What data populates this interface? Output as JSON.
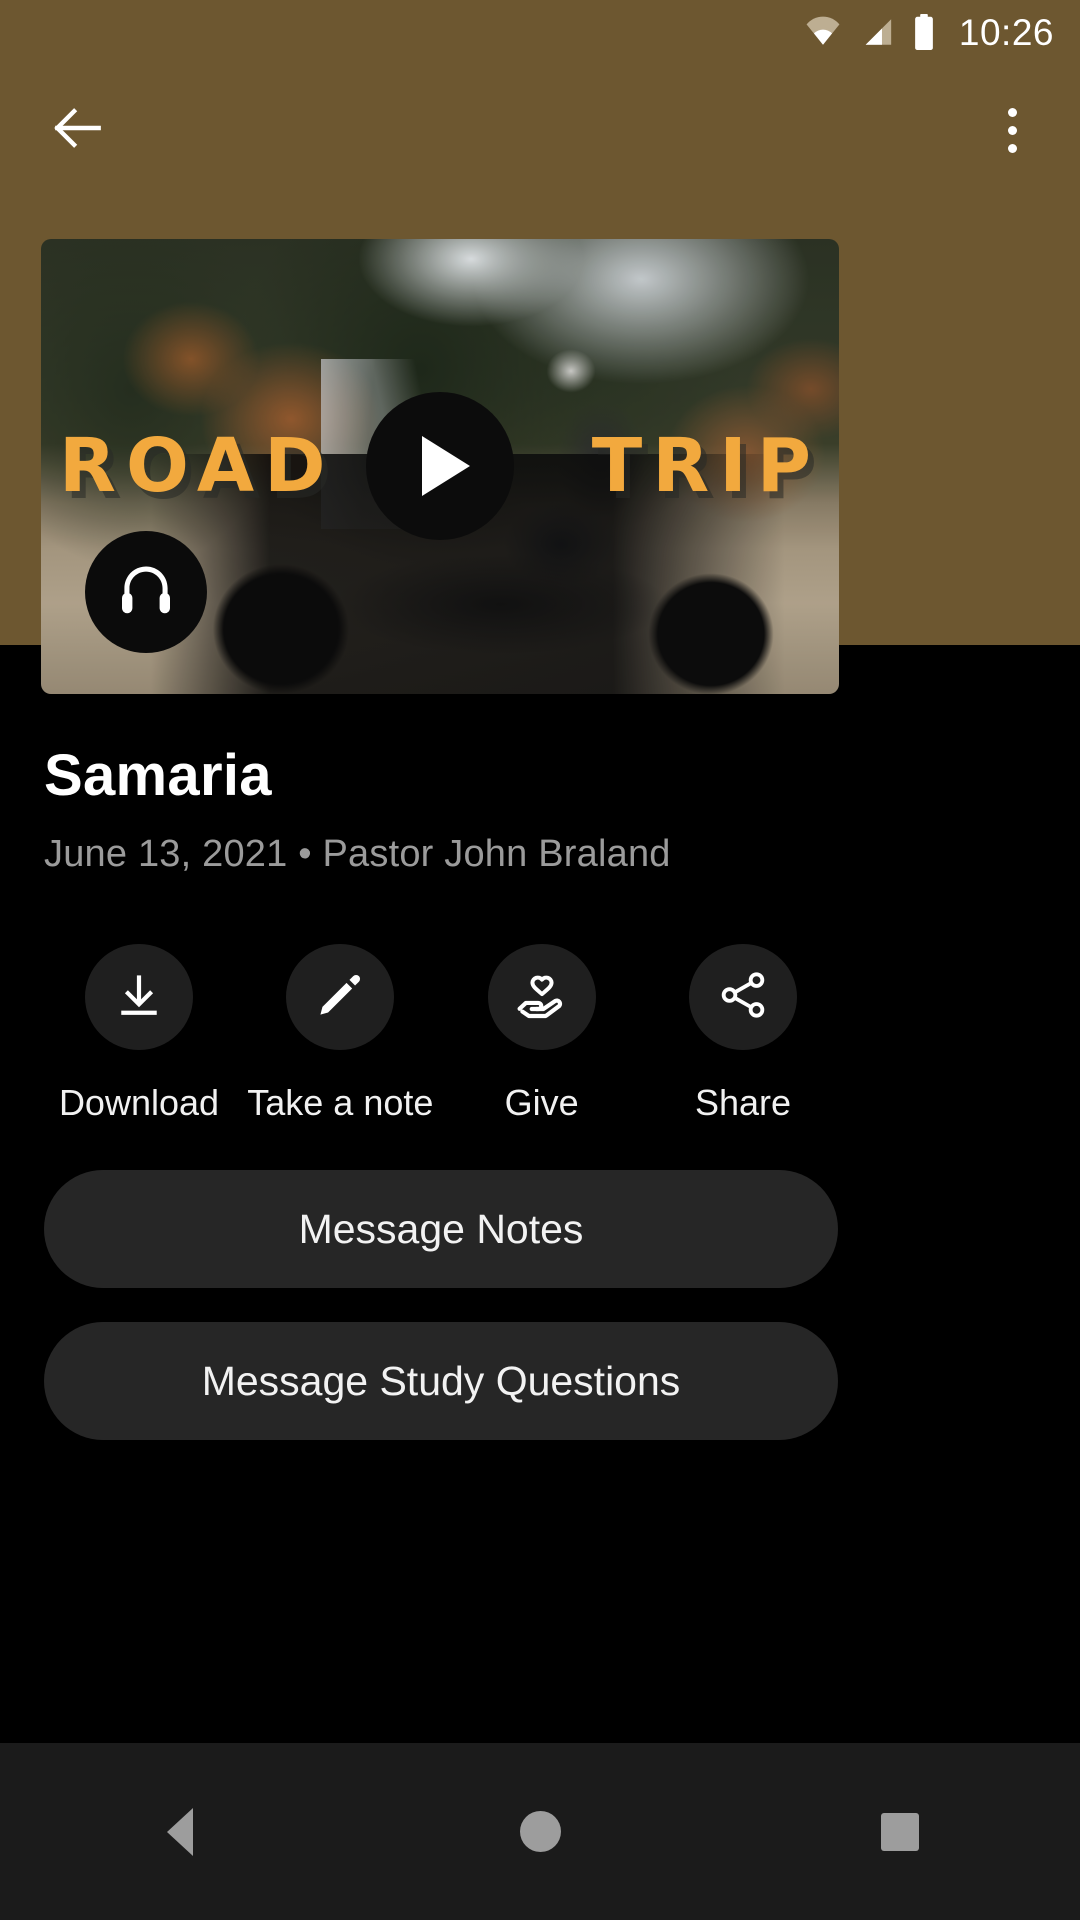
{
  "status_bar": {
    "time": "10:26",
    "icons": [
      "wifi-icon",
      "cellular-signal-icon",
      "battery-icon"
    ]
  },
  "app_bar": {
    "back_icon": "back-arrow-icon",
    "overflow_icon": "overflow-menu-icon"
  },
  "media": {
    "wordmark_left": "ROAD",
    "wordmark_right": "TRIP",
    "play_icon": "play-icon",
    "audio_icon": "headphones-icon"
  },
  "sermon": {
    "title": "Samaria",
    "meta": "June 13, 2021 • Pastor John Braland",
    "date": "June 13, 2021",
    "speaker": "Pastor John Braland"
  },
  "actions": [
    {
      "label": "Download",
      "icon": "download-icon"
    },
    {
      "label": "Take a note",
      "icon": "pencil-icon"
    },
    {
      "label": "Give",
      "icon": "hand-heart-icon"
    },
    {
      "label": "Share",
      "icon": "share-icon"
    }
  ],
  "buttons": {
    "notes": "Message Notes",
    "study_questions": "Message Study Questions"
  },
  "nav_bar": {
    "back": "nav-back-icon",
    "home": "nav-home-icon",
    "recents": "nav-recents-icon"
  },
  "colors": {
    "header_bg": "#6D5730",
    "page_bg": "#000000",
    "accent_amber": "#F2A93E",
    "circle_bg": "#1F1F1F",
    "pill_bg": "#262626",
    "muted_text": "#9B9B9B"
  }
}
